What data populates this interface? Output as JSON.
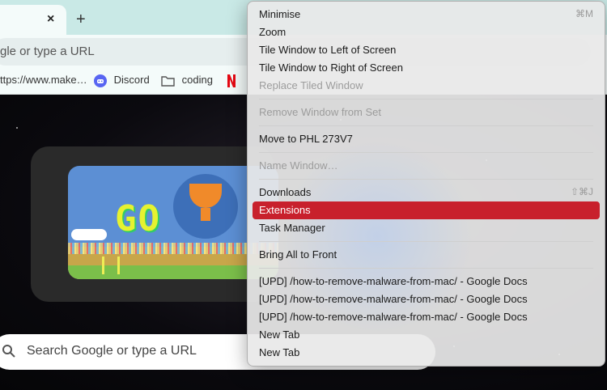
{
  "browser": {
    "tab_close": "×",
    "new_tab": "+",
    "omnibox_placeholder": "gle or type a URL",
    "bookmarks": [
      {
        "label": "ttps://www.make…",
        "icon": "globe-icon"
      },
      {
        "label": "Discord",
        "icon": "discord-icon"
      },
      {
        "label": "coding",
        "icon": "folder-icon"
      },
      {
        "label": "N",
        "icon": "netflix-icon"
      }
    ]
  },
  "ntp": {
    "doodle_text": "GO",
    "search_placeholder": "Search Google or type a URL"
  },
  "menu": {
    "items": [
      {
        "label": "Minimise",
        "shortcut": "⌘M"
      },
      {
        "label": "Zoom"
      },
      {
        "label": "Tile Window to Left of Screen"
      },
      {
        "label": "Tile Window to Right of Screen"
      },
      {
        "label": "Replace Tiled Window",
        "disabled": true
      },
      {
        "label": "Remove Window from Set",
        "disabled": true
      },
      {
        "label": "Move to PHL 273V7"
      },
      {
        "label": "Name Window…",
        "disabled": true
      },
      {
        "label": "Downloads",
        "shortcut": "⇧⌘J"
      },
      {
        "label": "Extensions",
        "highlighted": true
      },
      {
        "label": "Task Manager"
      },
      {
        "label": "Bring All to Front"
      },
      {
        "label": "[UPD] /how-to-remove-malware-from-mac/ - Google Docs"
      },
      {
        "label": "[UPD] /how-to-remove-malware-from-mac/ - Google Docs"
      },
      {
        "label": "[UPD] /how-to-remove-malware-from-mac/ - Google Docs"
      },
      {
        "label": "New Tab"
      },
      {
        "label": "New Tab"
      }
    ]
  },
  "colors": {
    "highlight": "#c8202c",
    "tabstrip": "#c9e9e6"
  }
}
